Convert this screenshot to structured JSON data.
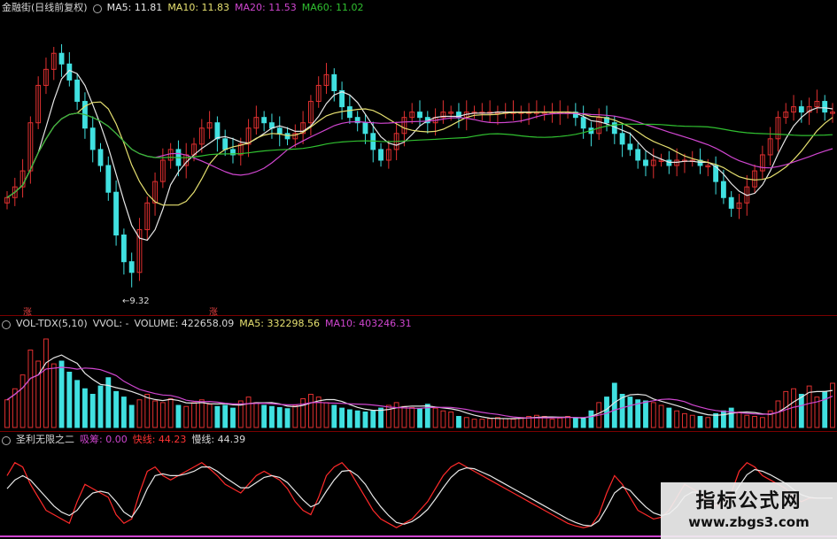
{
  "price_header": {
    "title": "金融街(日线前复权)",
    "ma5": "MA5: 11.81",
    "ma10": "MA10: 11.83",
    "ma20": "MA20: 11.53",
    "ma60": "MA60: 11.02"
  },
  "price_pane": {
    "low_marker": "←9.32",
    "flags": [
      "涨",
      "涨"
    ]
  },
  "volume_header": {
    "title": "VOL-TDX(5,10)",
    "vvol": "VVOL: -",
    "volume": "VOLUME: 422658.09",
    "ma5": "MA5: 332298.56",
    "ma10": "MA10: 403246.31"
  },
  "indicator_header": {
    "title": "圣利无限之二",
    "xichou": "吸筹: 0.00",
    "fast": "快线: 44.23",
    "slow": "慢线: 44.39"
  },
  "watermark": {
    "title": "指标公式网",
    "url": "www.zbgs3.com"
  },
  "colors": {
    "up": "#e03030",
    "down": "#40e0e0",
    "ma5": "#e6e6e6",
    "ma10": "#e6e070",
    "ma20": "#d046d0",
    "ma60": "#30c030",
    "separator": "#7a0000"
  },
  "chart_data": {
    "type": "candlestick",
    "price_low": 9.32,
    "price_range": [
      9.0,
      14.3
    ],
    "ma_latest": {
      "MA5": 11.81,
      "MA10": 11.83,
      "MA20": 11.53,
      "MA60": 11.02
    },
    "volume_latest": {
      "VOLUME": 422658.09,
      "MA5": 332298.56,
      "MA10": 403246.31
    },
    "indicator_latest": {
      "吸筹": 0.0,
      "快线": 44.23,
      "慢线": 44.39
    },
    "close": [
      11.0,
      11.2,
      11.5,
      12.4,
      13.1,
      13.4,
      13.7,
      13.5,
      13.2,
      12.8,
      12.3,
      11.9,
      11.6,
      11.1,
      10.3,
      9.8,
      9.6,
      10.4,
      10.9,
      11.3,
      11.7,
      11.9,
      11.6,
      11.8,
      12.0,
      12.3,
      12.4,
      12.1,
      11.9,
      11.8,
      12.0,
      12.3,
      12.5,
      12.4,
      12.3,
      12.2,
      12.1,
      12.2,
      12.4,
      12.8,
      13.1,
      13.3,
      13.0,
      12.7,
      12.5,
      12.4,
      12.2,
      11.9,
      11.7,
      11.9,
      12.2,
      12.5,
      12.6,
      12.5,
      12.4,
      12.5,
      12.6,
      12.6,
      12.5,
      12.6,
      12.6,
      12.6,
      12.6,
      12.6,
      12.6,
      12.6,
      12.6,
      12.6,
      12.6,
      12.6,
      12.6,
      12.6,
      12.6,
      12.5,
      12.3,
      12.2,
      12.5,
      12.4,
      12.2,
      12.0,
      11.9,
      11.7,
      11.6,
      11.7,
      11.7,
      11.6,
      11.7,
      11.7,
      11.7,
      11.6,
      11.6,
      11.3,
      11.0,
      10.8,
      10.9,
      11.2,
      11.5,
      11.8,
      12.1,
      12.5,
      12.6,
      12.7,
      12.6,
      12.7,
      12.8,
      12.6,
      12.6
    ],
    "volume": [
      50,
      70,
      95,
      140,
      120,
      160,
      115,
      120,
      100,
      85,
      70,
      60,
      75,
      90,
      65,
      55,
      40,
      50,
      60,
      48,
      45,
      52,
      40,
      38,
      45,
      50,
      42,
      38,
      40,
      35,
      48,
      55,
      45,
      40,
      38,
      36,
      34,
      40,
      52,
      60,
      55,
      45,
      40,
      35,
      32,
      30,
      28,
      30,
      35,
      40,
      45,
      38,
      36,
      34,
      42,
      35,
      30,
      28,
      20,
      18,
      15,
      15,
      16,
      18,
      16,
      15,
      18,
      20,
      22,
      20,
      15,
      17,
      20,
      18,
      16,
      30,
      45,
      55,
      80,
      60,
      55,
      50,
      48,
      45,
      40,
      35,
      30,
      25,
      22,
      20,
      18,
      25,
      30,
      35,
      28,
      22,
      20,
      18,
      30,
      48,
      65,
      70,
      60,
      75,
      55,
      65,
      80
    ],
    "fast_line": [
      70,
      85,
      80,
      60,
      45,
      30,
      25,
      20,
      15,
      40,
      60,
      55,
      50,
      45,
      25,
      15,
      20,
      50,
      75,
      80,
      70,
      65,
      70,
      75,
      80,
      85,
      78,
      70,
      60,
      55,
      50,
      60,
      70,
      75,
      70,
      65,
      55,
      40,
      30,
      25,
      45,
      70,
      80,
      85,
      75,
      60,
      45,
      30,
      20,
      15,
      10,
      15,
      20,
      30,
      40,
      55,
      70,
      80,
      85,
      80,
      75,
      70,
      65,
      60,
      55,
      50,
      45,
      40,
      35,
      30,
      25,
      20,
      15,
      12,
      10,
      12,
      25,
      50,
      70,
      60,
      45,
      30,
      25,
      20,
      22,
      30,
      45,
      60,
      55,
      50,
      40,
      35,
      40,
      50,
      75,
      85,
      80,
      70,
      65,
      60,
      55,
      45,
      40,
      44,
      44,
      44,
      44
    ],
    "slow_line": [
      55,
      65,
      70,
      65,
      55,
      45,
      35,
      28,
      24,
      30,
      42,
      50,
      52,
      50,
      40,
      28,
      22,
      35,
      55,
      70,
      72,
      70,
      70,
      72,
      75,
      80,
      80,
      75,
      68,
      62,
      56,
      56,
      62,
      68,
      70,
      68,
      62,
      52,
      42,
      34,
      38,
      52,
      65,
      75,
      76,
      70,
      60,
      46,
      34,
      24,
      16,
      14,
      17,
      23,
      31,
      43,
      56,
      68,
      76,
      79,
      78,
      74,
      70,
      65,
      60,
      55,
      50,
      45,
      40,
      35,
      30,
      25,
      20,
      16,
      13,
      12,
      18,
      33,
      50,
      57,
      53,
      43,
      34,
      27,
      24,
      26,
      34,
      46,
      51,
      51,
      46,
      40,
      39,
      44,
      58,
      71,
      77,
      75,
      71,
      66,
      61,
      54,
      48,
      45,
      44,
      44,
      44
    ]
  }
}
